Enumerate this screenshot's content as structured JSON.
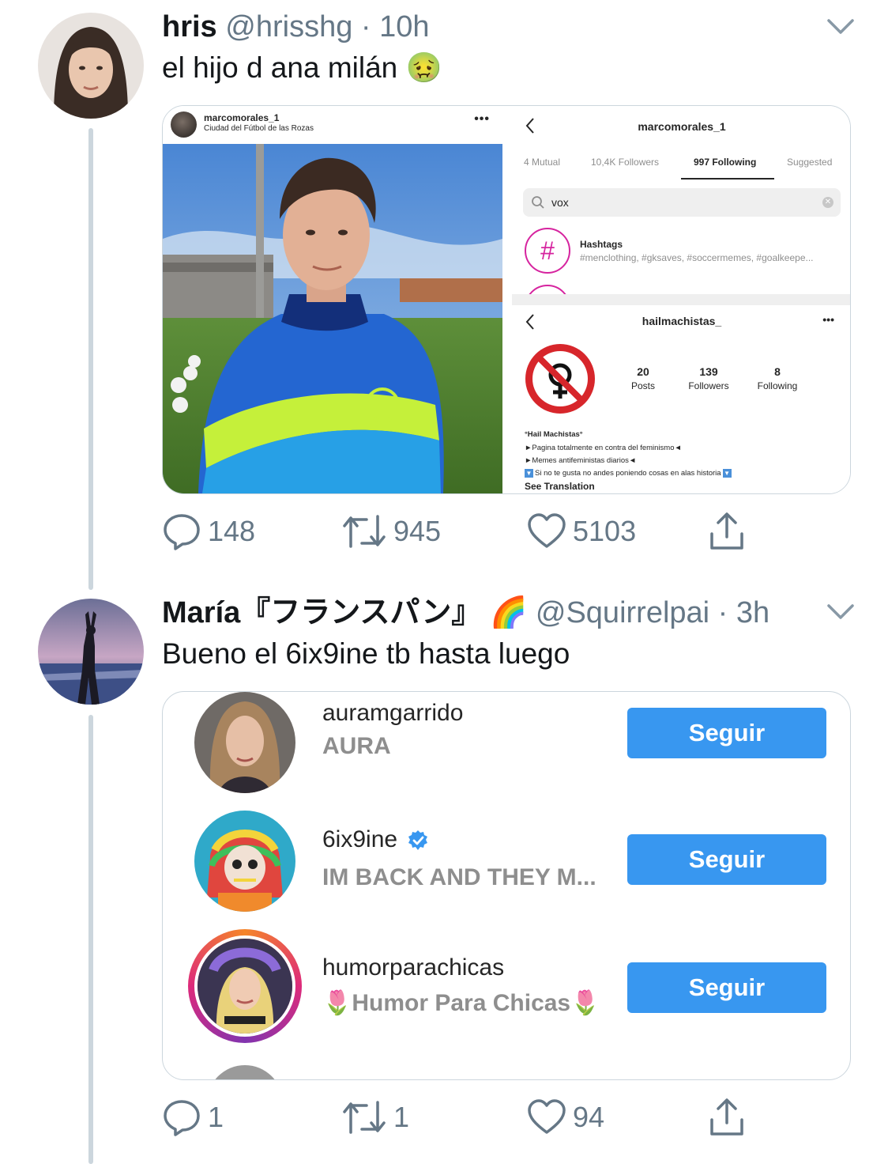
{
  "tweet1": {
    "name": "hris",
    "handle_time": "@hrisshg · 10h",
    "text": "el hijo d ana milán 🤢",
    "actions": {
      "replies": "148",
      "retweets": "945",
      "likes": "5103"
    },
    "media": {
      "post": {
        "username": "marcomorales_1",
        "location": "Ciudad del Fútbol de las Rozas",
        "more": "•••"
      },
      "following": {
        "username": "marcomorales_1",
        "tabs": [
          "4 Mutual",
          "10,4K Followers",
          "997 Following",
          "Suggested"
        ],
        "search_value": "vox",
        "hashtags_title": "Hashtags",
        "hashtags_sub": "#menclothing, #gksaves, #soccermemes, #goalkeepe..."
      },
      "profile": {
        "username": "hailmachistas_",
        "more": "•••",
        "stats": [
          {
            "num": "20",
            "label": "Posts"
          },
          {
            "num": "139",
            "label": "Followers"
          },
          {
            "num": "8",
            "label": "Following"
          }
        ],
        "bio_title": "°Hail Machistas°",
        "bio_lines": [
          "►Pagina totalmente en contra del feminismo◄",
          "►Memes antifeministas diarios◄",
          "Si no te gusta no andes poniendo cosas en alas historia"
        ],
        "see_translation": "See Translation"
      }
    }
  },
  "tweet2": {
    "name": "María『フランスパン』",
    "flag_emoji": "🌈",
    "handle_time": "@Squirrelpai · 3h",
    "text": "Bueno el 6ix9ine tb hasta luego",
    "actions": {
      "replies": "1",
      "retweets": "1",
      "likes": "94"
    },
    "suggestions": [
      {
        "username": "auramgarrido",
        "subtitle": "AURA",
        "button": "Seguir"
      },
      {
        "username": "6ix9ine",
        "subtitle": "IM BACK AND THEY M...",
        "button": "Seguir"
      },
      {
        "username": "humorparachicas",
        "subtitle": "🌷Humor Para Chicas🌷",
        "button": "Seguir"
      }
    ]
  },
  "colors": {
    "twitter_gray": "#657786",
    "ig_blue": "#3897f0",
    "thread_line": "#ccd6dd"
  }
}
